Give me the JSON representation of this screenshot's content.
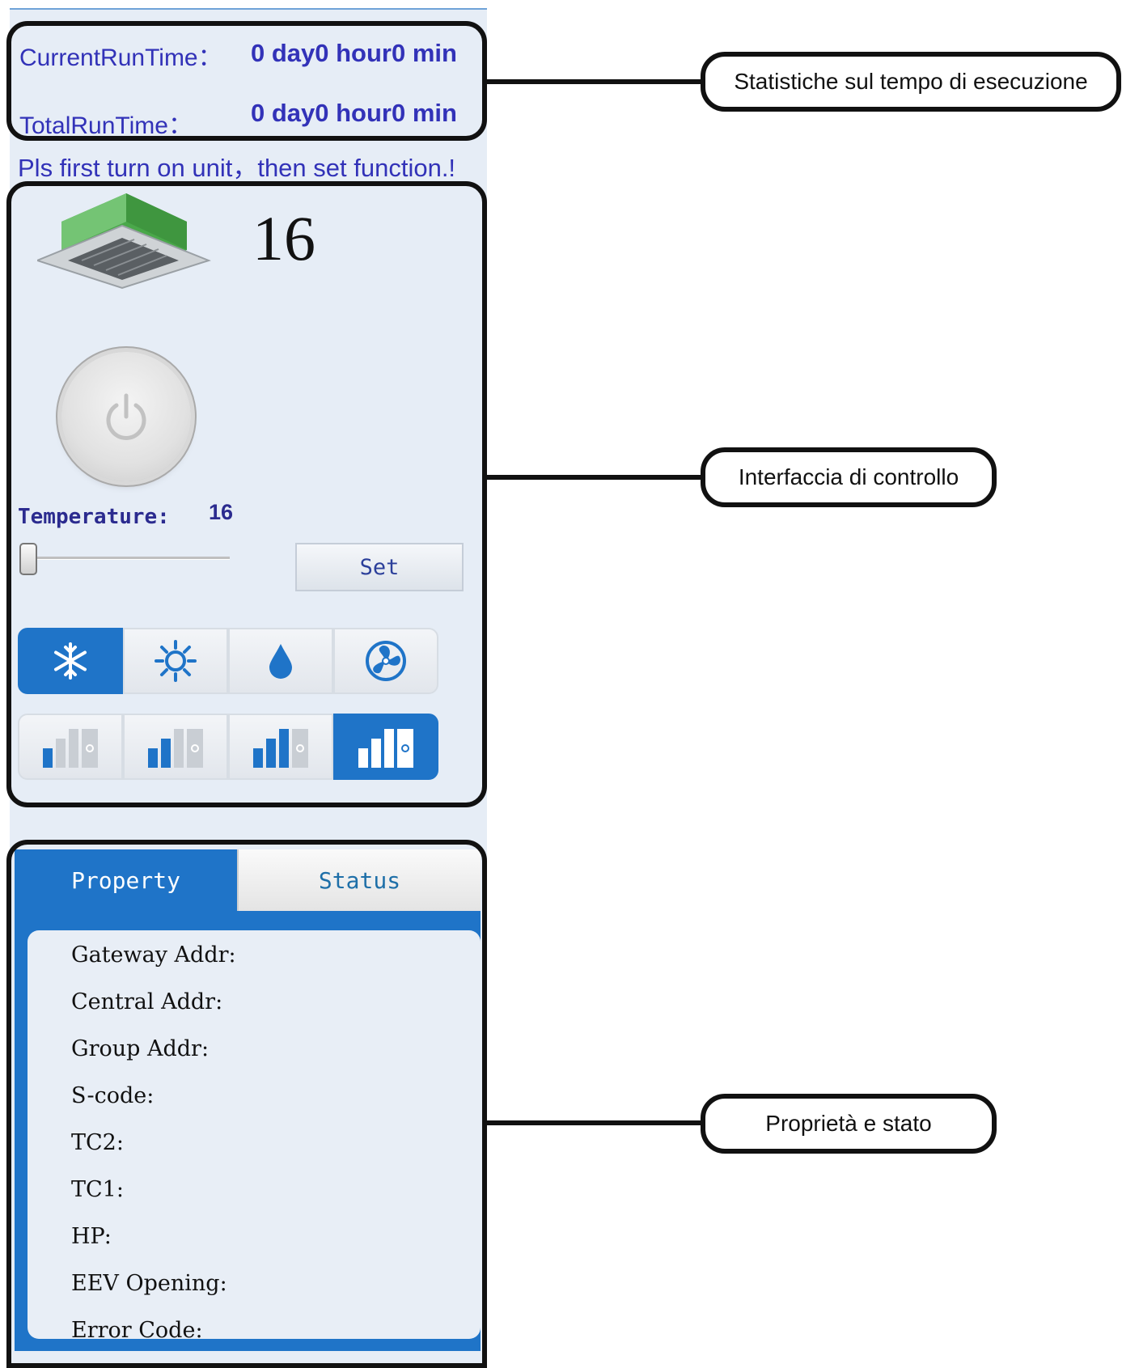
{
  "runtime": {
    "current_label": "CurrentRunTime：",
    "current_value": "0 day0 hour0 min",
    "total_label": "TotalRunTime：",
    "total_value": "0 day0 hour0 min"
  },
  "warning": "Pls first turn on unit，then set function.!",
  "unit": {
    "display_temp": "16",
    "icon": "ceiling-cassette-icon"
  },
  "power": {
    "icon": "power-icon"
  },
  "temperature": {
    "label": "Temperature:",
    "value": "16",
    "slider_level": 0
  },
  "set_label": "Set",
  "modes": [
    {
      "name": "cool",
      "icon": "snowflake-icon",
      "active": true
    },
    {
      "name": "heat",
      "icon": "sun-icon",
      "active": false
    },
    {
      "name": "dry",
      "icon": "water-drop-icon",
      "active": false
    },
    {
      "name": "fan",
      "icon": "fan-icon",
      "active": false
    }
  ],
  "fan_speeds": [
    {
      "level": 1,
      "active": false
    },
    {
      "level": 2,
      "active": false
    },
    {
      "level": 3,
      "active": false
    },
    {
      "level": 4,
      "active": true
    }
  ],
  "tabs": {
    "property": "Property",
    "status": "Status"
  },
  "properties": [
    "Gateway Addr:",
    "Central Addr:",
    "Group Addr:",
    "S-code:",
    "TC2:",
    "TC1:",
    "HP:",
    "EEV Opening:",
    "Error Code:"
  ],
  "callouts": {
    "runtime": "Statistiche sul tempo di esecuzione",
    "control": "Interfaccia di controllo",
    "property": "Proprietà e stato"
  },
  "colors": {
    "accent": "#1f74c8",
    "text_blue": "#3232b8",
    "panel_bg": "#e6edf6"
  }
}
